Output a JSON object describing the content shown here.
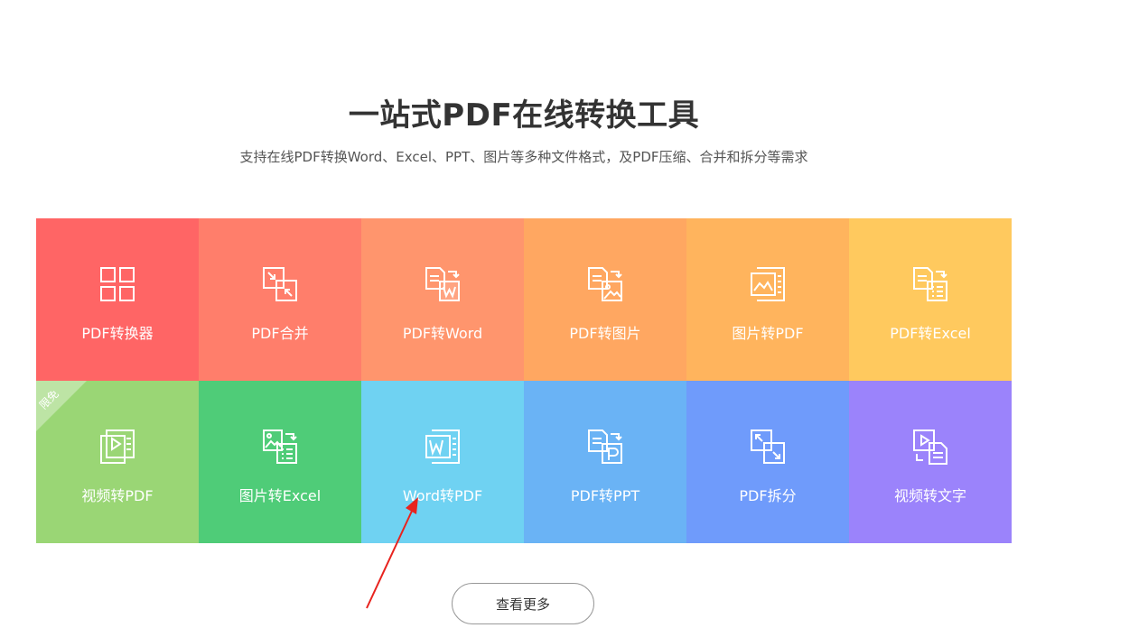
{
  "hero": {
    "title": "一站式PDF在线转换工具",
    "subtitle": "支持在线PDF转换Word、Excel、PPT、图片等多种文件格式，及PDF压缩、合并和拆分等需求"
  },
  "tools": [
    {
      "label": "PDF转换器",
      "color": "#ff6565",
      "icon": "grid-four-icon"
    },
    {
      "label": "PDF合并",
      "color": "#ff7e6b",
      "icon": "merge-icon"
    },
    {
      "label": "PDF转Word",
      "color": "#ff956d",
      "icon": "pdf-to-word-icon"
    },
    {
      "label": "PDF转图片",
      "color": "#ffa761",
      "icon": "pdf-to-image-icon"
    },
    {
      "label": "图片转PDF",
      "color": "#ffb45d",
      "icon": "image-to-pdf-icon"
    },
    {
      "label": "PDF转Excel",
      "color": "#ffc95e",
      "icon": "pdf-to-excel-icon"
    },
    {
      "label": "视频转PDF",
      "color": "#9ad675",
      "icon": "video-to-pdf-icon",
      "badge": "限免"
    },
    {
      "label": "图片转Excel",
      "color": "#4fcc78",
      "icon": "image-to-excel-icon"
    },
    {
      "label": "Word转PDF",
      "color": "#6fd2f2",
      "icon": "word-to-pdf-icon"
    },
    {
      "label": "PDF转PPT",
      "color": "#6ab3f5",
      "icon": "pdf-to-ppt-icon"
    },
    {
      "label": "PDF拆分",
      "color": "#6f9bfb",
      "icon": "split-icon"
    },
    {
      "label": "视频转文字",
      "color": "#9b83fb",
      "icon": "video-to-text-icon"
    }
  ],
  "more_button": {
    "label": "查看更多"
  },
  "annotation": {
    "arrow_color": "#e8231e",
    "arrow_icon": "red-arrow-icon"
  }
}
